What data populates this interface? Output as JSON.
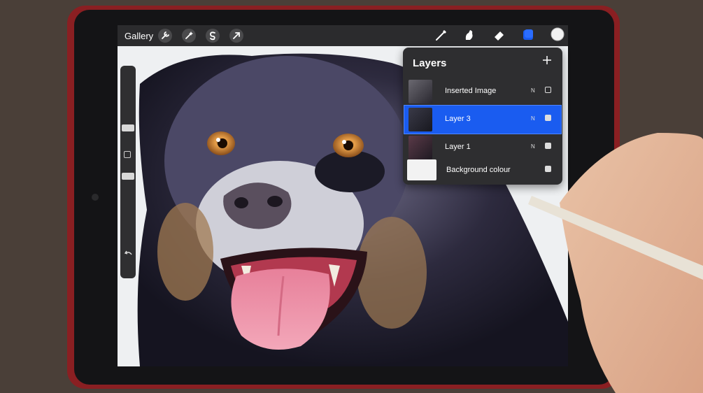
{
  "app": {
    "gallery_label": "Gallery",
    "accent_color": "#1a5cf0"
  },
  "toolbar": {
    "left_icons": [
      "wrench-icon",
      "magic-wand-icon",
      "selection-icon",
      "transform-arrow-icon"
    ],
    "right_icons": [
      "brush-icon",
      "smudge-icon",
      "eraser-icon",
      "layers-icon",
      "color-swatch"
    ],
    "current_color": "#f2f2f2"
  },
  "layers_panel": {
    "title": "Layers",
    "add_symbol": "+",
    "layers": [
      {
        "name": "Inserted Image",
        "blend": "N",
        "visible": false,
        "active": false
      },
      {
        "name": "Layer 3",
        "blend": "N",
        "visible": true,
        "active": true
      },
      {
        "name": "Layer 1",
        "blend": "N",
        "visible": true,
        "active": false
      },
      {
        "name": "Background colour",
        "blend": "",
        "visible": true,
        "active": false
      }
    ]
  }
}
